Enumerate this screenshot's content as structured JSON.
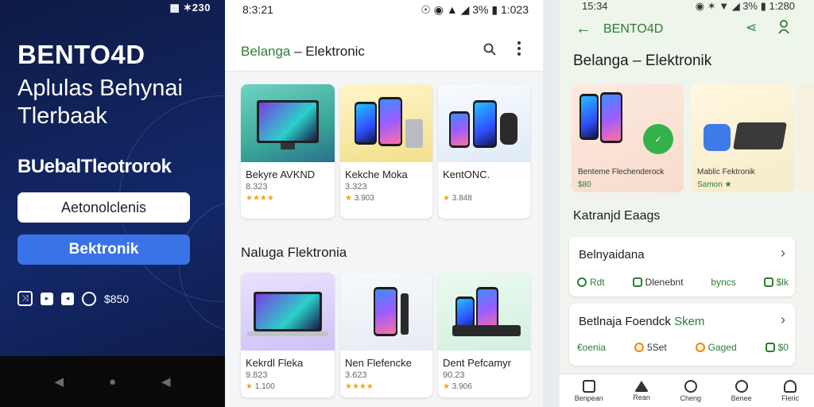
{
  "promo": {
    "status": "▩ ✶230",
    "brand": "BENTO4D",
    "tagline": "Aplulas Behynai Tlerbaak",
    "subtitle": "BUebalTleotrorok",
    "outline_button": "Aetonolclenis",
    "primary_button": "Bektronik",
    "footer_text": "$850"
  },
  "shop": {
    "status_time": "8:3:21",
    "status_right": "☉ ◉ ▲ ◢ 3% ▮ 1:023",
    "title_part1": "Belanga",
    "title_part2": " – Elektronic",
    "section_title": "Naluga Flektronia",
    "products_top": [
      {
        "name": "Bekyre AVKND",
        "price": "8.323",
        "stars": "★★★★",
        "rating": ""
      },
      {
        "name": "Kekche Moka",
        "price": "3.323",
        "stars": "★",
        "rating": "3.903"
      },
      {
        "name": "KentONC.",
        "price": "",
        "stars": "★",
        "rating": "3.848"
      }
    ],
    "products_bottom": [
      {
        "name": "Kekrdl Fleka",
        "price": "9.823",
        "stars": "★",
        "rating": "1.100"
      },
      {
        "name": "Nen Flefencke",
        "price": "3.623",
        "stars": "★★★★",
        "rating": ""
      },
      {
        "name": "Dent Pefcamyr",
        "price": "90.23",
        "stars": "★",
        "rating": "3.906"
      }
    ]
  },
  "green": {
    "status_time": "15:34",
    "status_right": "◉ ✶ ▼ ◢ 3% ▮ 1:280",
    "app_name": "BENTO4D",
    "heading": "Belanga – Elektronik",
    "tiles": [
      {
        "name": "Benteme Flechenderock",
        "sub": "$80"
      },
      {
        "name": "Mablic Fektronik",
        "sub": "Samon ★"
      }
    ],
    "section": "Katranjd Eaags",
    "rows": [
      {
        "title": "Belnyaidana",
        "title_accent": "",
        "chips": [
          "Rdt",
          "Dlenebnt",
          "byncs",
          "$lk"
        ]
      },
      {
        "title": "Betlnaja Foendck",
        "title_accent": " Skem",
        "chips": [
          "€oenia",
          "5Set",
          "Gaged",
          "$0"
        ]
      }
    ],
    "nav": [
      "Benpean",
      "Rean",
      "Cheng",
      "Benee",
      "Fleric"
    ]
  }
}
